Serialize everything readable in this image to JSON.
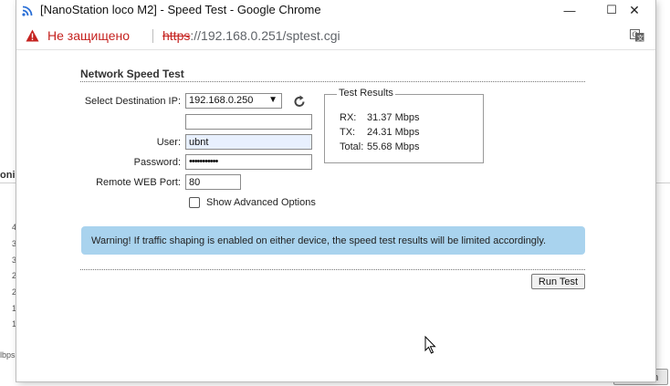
{
  "background": {
    "fragment_1": "oni",
    "fragment_2": "4",
    "fragment_3": "3",
    "fragment_4": "3",
    "fragment_5": "2",
    "fragment_6": "2",
    "fragment_7": "1",
    "fragment_8": "1",
    "fragment_9": "lbps",
    "refresh_button": "Refresh"
  },
  "window": {
    "title": "[NanoStation loco M2] - Speed Test - Google Chrome",
    "minimize_glyph": "—",
    "maximize_glyph": "☐",
    "close_glyph": "✕"
  },
  "address_bar": {
    "security_label": "Не защищено",
    "url_protocol": "https",
    "url_rest": "://192.168.0.251/sptest.cgi"
  },
  "form": {
    "section_title": "Network Speed Test",
    "destination_label": "Select Destination IP:",
    "destination_value": "192.168.0.250",
    "custom_ip_value": "",
    "user_label": "User:",
    "user_value": "ubnt",
    "password_label": "Password:",
    "password_value": "•••••••••••",
    "port_label": "Remote WEB Port:",
    "port_value": "80",
    "advanced_label": "Show Advanced Options",
    "run_button": "Run Test"
  },
  "results": {
    "legend": "Test Results",
    "rx_label": "RX:",
    "rx_value": "31.37 Mbps",
    "tx_label": "TX:",
    "tx_value": "24.31 Mbps",
    "total_label": "Total:",
    "total_value": "55.68 Mbps"
  },
  "warning": {
    "text": "Warning! If traffic shaping is enabled on either device, the speed test results will be limited accordingly."
  },
  "colors": {
    "warning_bg": "#a9d3ee",
    "not_secure": "#c5221f"
  }
}
